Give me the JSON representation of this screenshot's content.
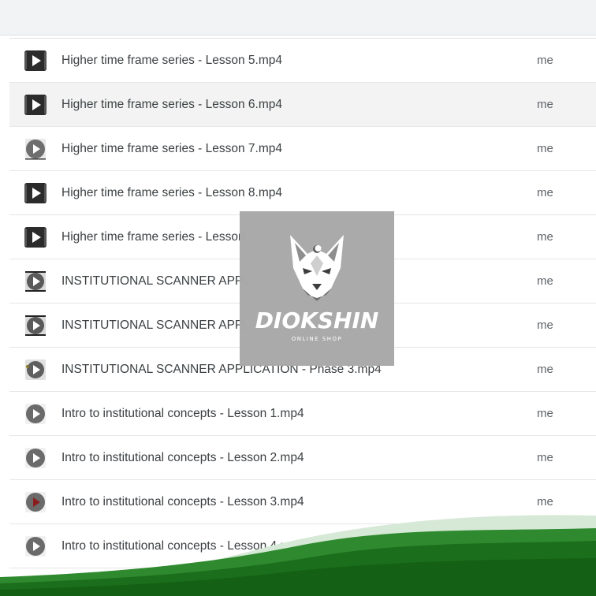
{
  "files": [
    {
      "name": "Higher time frame series - Lesson 5.mp4",
      "owner": "me",
      "icon": "video-file-icon"
    },
    {
      "name": "Higher time frame series - Lesson 6.mp4",
      "owner": "me",
      "icon": "video-file-icon"
    },
    {
      "name": "Higher time frame series - Lesson 7.mp4",
      "owner": "me",
      "icon": "video-thumbnail-icon"
    },
    {
      "name": "Higher time frame series - Lesson 8.mp4",
      "owner": "me",
      "icon": "video-file-icon"
    },
    {
      "name": "Higher time frame series - Lesson",
      "owner": "me",
      "icon": "video-file-icon"
    },
    {
      "name": "INSTITUTIONAL SCANNER APPL",
      "owner": "me",
      "icon": "video-thumbnail-icon"
    },
    {
      "name": "INSTITUTIONAL SCANNER APPL",
      "owner": "me",
      "icon": "video-thumbnail-icon"
    },
    {
      "name": "INSTITUTIONAL SCANNER APPLICATION - Phase 3.mp4",
      "owner": "me",
      "icon": "video-thumbnail-icon"
    },
    {
      "name": "Intro to institutional concepts  - Lesson 1.mp4",
      "owner": "me",
      "icon": "video-thumbnail-icon"
    },
    {
      "name": "Intro to institutional concepts  - Lesson 2.mp4",
      "owner": "me",
      "icon": "video-thumbnail-icon"
    },
    {
      "name": "Intro to institutional concepts  - Lesson 3.mp4",
      "owner": "me",
      "icon": "video-thumbnail-red-icon"
    },
    {
      "name": "Intro to institutional concepts  - Lesson 4.mp4",
      "owner": "me",
      "icon": "video-thumbnail-icon"
    }
  ],
  "watermark": {
    "brand": "DIOKSHIN",
    "tagline": "ONLINE SHOP"
  },
  "colors": {
    "accent_green": "#1d7a1d",
    "light_green": "#cfe3cf",
    "watermark_bg": "#a9a9a9"
  }
}
